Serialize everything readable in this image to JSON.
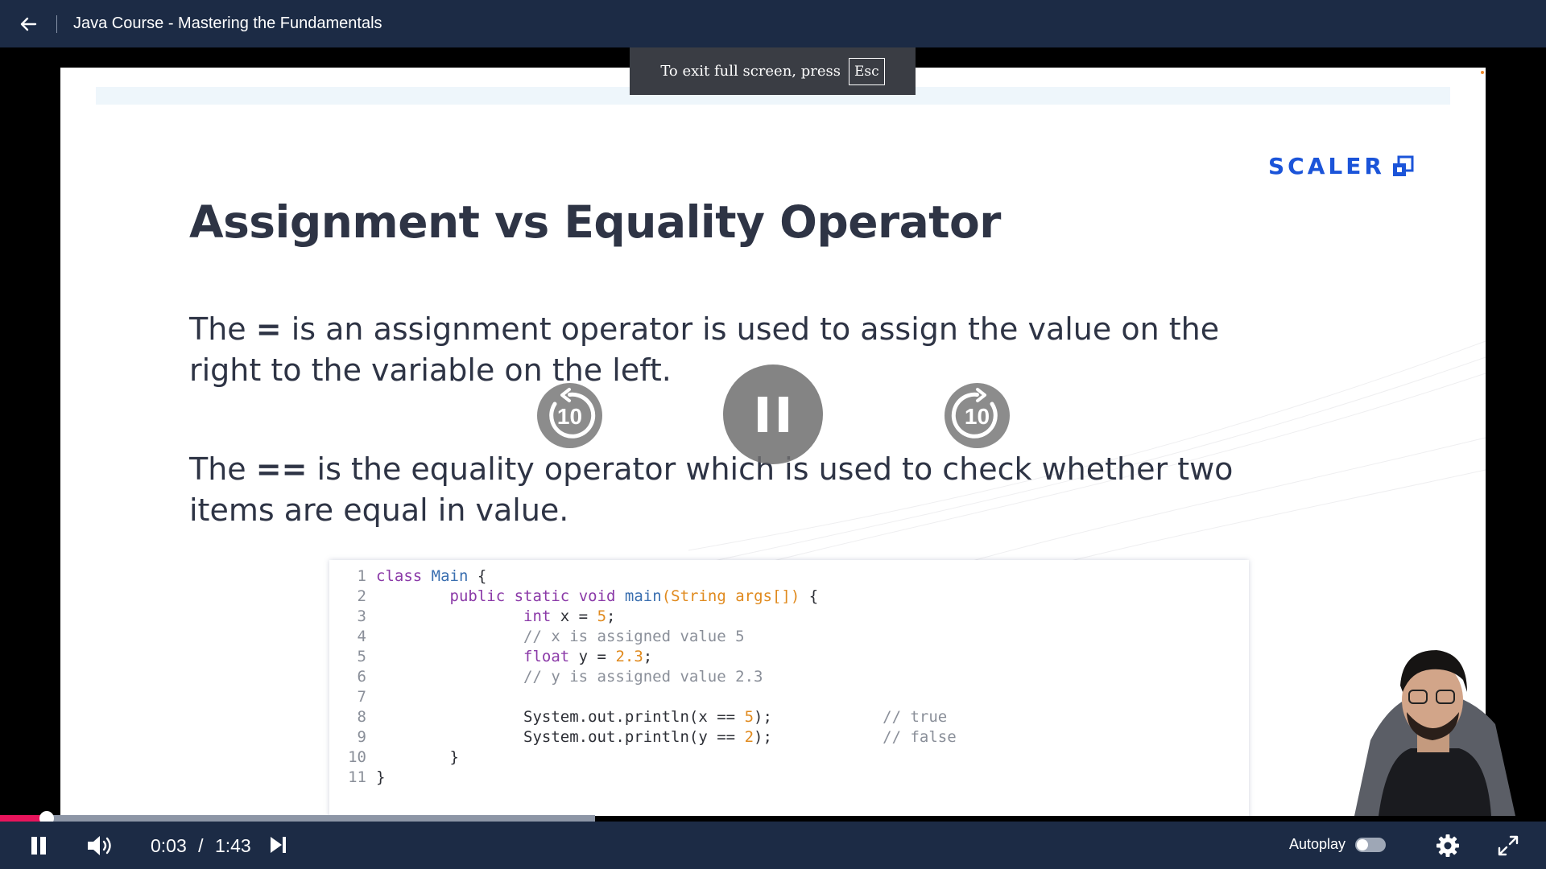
{
  "header": {
    "title": "Java Course - Mastering the Fundamentals",
    "back_icon": "arrow-left-icon"
  },
  "fullscreen_banner": {
    "text": "To exit full screen, press",
    "key": "Esc"
  },
  "slide": {
    "brand": "SCALER",
    "title": "Assignment vs Equality Operator",
    "para1": {
      "before": "The ",
      "op": "=",
      "after": " is an assignment operator is used to assign the value on the right to the variable on the left."
    },
    "para2": {
      "before": "The ",
      "op": "==",
      "after": " is the equality operator which is used to check whether two items are equal in value."
    },
    "code": {
      "line_numbers": [
        "1",
        "2",
        "3",
        "4",
        "5",
        "6",
        "7",
        "8",
        "9",
        "10",
        "11"
      ],
      "lines": [
        "class Main {",
        "        public static void main(String args[]) {",
        "                int x = 5;",
        "                // x is assigned value 5",
        "                float y = 2.3;",
        "                // y is assigned value 2.3",
        "",
        "                System.out.println(x == 5);            // true",
        "                System.out.println(y == 2);            // false",
        "        }",
        "}"
      ]
    }
  },
  "overlay_controls": {
    "rewind_label": "10",
    "forward_label": "10"
  },
  "player": {
    "current_time": "0:03",
    "separator": "/",
    "duration": "1:43",
    "played_fraction": 0.03,
    "buffered_fraction": 0.385,
    "autoplay_label": "Autoplay",
    "autoplay_on": false,
    "accent_color": "#e8145c",
    "bar_color": "#1c2b45"
  }
}
